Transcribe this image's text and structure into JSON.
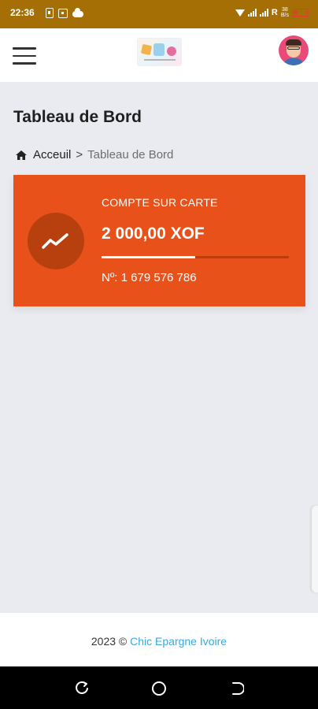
{
  "status_bar": {
    "time": "22:36",
    "network": "R",
    "speed_top": "38",
    "speed_bottom": "B/s",
    "battery": "10"
  },
  "header": {
    "menu_icon": "hamburger-menu-icon",
    "logo": "chic-epargne-logo",
    "avatar": "user-avatar"
  },
  "page": {
    "title": "Tableau de Bord"
  },
  "breadcrumb": {
    "home_icon": "home-icon",
    "home_label": "Acceuil",
    "separator": ">",
    "current": "Tableau de Bord"
  },
  "card": {
    "icon": "trending-up-icon",
    "label": "COMPTE SUR CARTE",
    "amount": "2 000,00 XOF",
    "progress": 0.5,
    "account": "Nº: 1 679 576 786",
    "bg_color": "#e8521a",
    "icon_bg_color": "#b8400f"
  },
  "footer": {
    "year": "2023 ©",
    "brand": "Chic Epargne Ivoire",
    "link_color": "#36a9e1"
  },
  "nav_bar": {
    "back_icon": "back-icon",
    "home_icon": "circle-home-icon",
    "recent_icon": "recent-apps-icon"
  }
}
